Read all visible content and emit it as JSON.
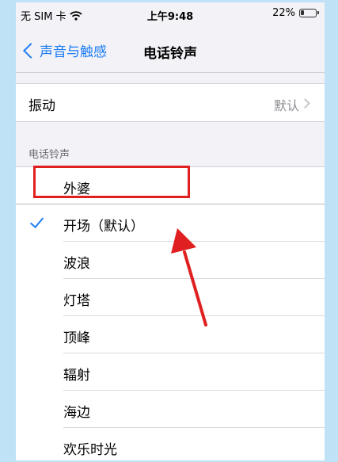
{
  "status_bar": {
    "carrier": "无 SIM 卡",
    "time": "上午9:48",
    "battery": "22%",
    "battery_level": 0.22
  },
  "nav": {
    "back_label": "声音与触感",
    "title": "电话铃声"
  },
  "vibration": {
    "label": "振动",
    "value": "默认"
  },
  "ringtones": {
    "section_title": "电话铃声",
    "highlighted": "外婆",
    "items": [
      {
        "label": "开场（默认）",
        "selected": true
      },
      {
        "label": "波浪",
        "selected": false
      },
      {
        "label": "灯塔",
        "selected": false
      },
      {
        "label": "顶峰",
        "selected": false
      },
      {
        "label": "辐射",
        "selected": false
      },
      {
        "label": "海边",
        "selected": false
      },
      {
        "label": "欢乐时光",
        "selected": false
      }
    ]
  },
  "colors": {
    "accent": "#1c7cf4",
    "annotation_red": "#e02020",
    "frame": "#bfe2f6"
  }
}
